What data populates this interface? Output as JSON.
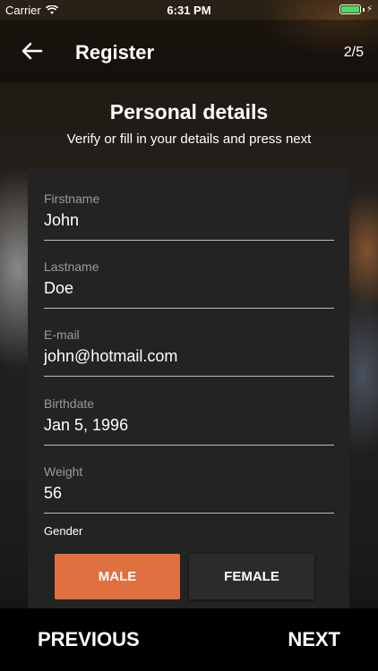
{
  "status_bar": {
    "carrier": "Carrier",
    "time": "6:31 PM",
    "wifi_icon": "wifi-icon",
    "battery_icon": "battery-icon"
  },
  "app_bar": {
    "back_icon": "arrow-left-icon",
    "title": "Register",
    "step": "2/5"
  },
  "header": {
    "title": "Personal details",
    "subtitle": "Verify or fill in your details and press next"
  },
  "form": {
    "firstname": {
      "label": "Firstname",
      "value": "John"
    },
    "lastname": {
      "label": "Lastname",
      "value": "Doe"
    },
    "email": {
      "label": "E-mail",
      "value": "john@hotmail.com"
    },
    "birthdate": {
      "label": "Birthdate",
      "value": "Jan 5, 1996"
    },
    "weight": {
      "label": "Weight",
      "value": "56"
    },
    "gender": {
      "label": "Gender",
      "male": "MALE",
      "female": "FEMALE",
      "selected": "MALE"
    }
  },
  "footer": {
    "previous": "PREVIOUS",
    "next": "NEXT"
  },
  "colors": {
    "accent": "#e07040",
    "card": "#232323",
    "battery": "#4cd964"
  }
}
